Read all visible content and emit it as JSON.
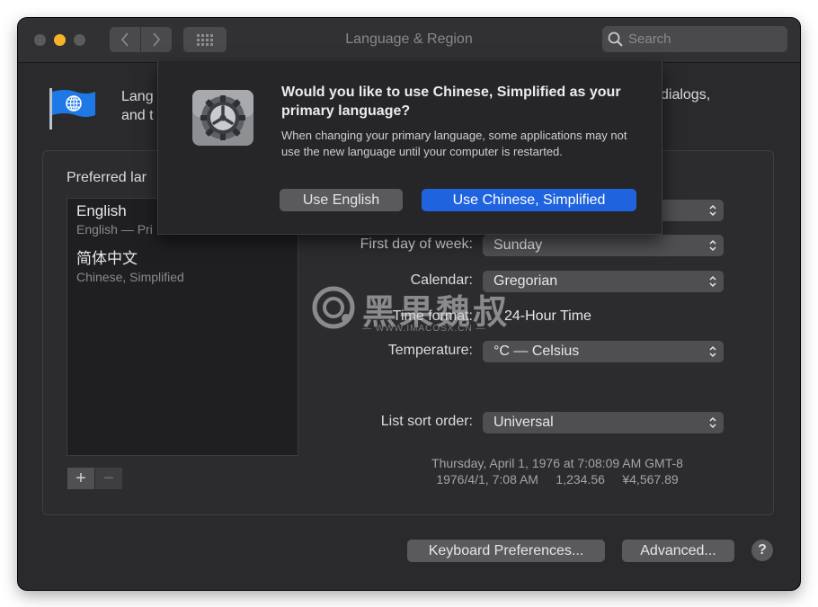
{
  "window": {
    "title": "Language & Region",
    "search_placeholder": "Search",
    "accent_color": "#1f63df"
  },
  "intro": {
    "line1": "Lang",
    "line2": "and t",
    "right_fragment": "dialogs,"
  },
  "preferred_languages": {
    "label": "Preferred lar",
    "items": [
      {
        "name": "English",
        "sub": "English — Pri"
      },
      {
        "name": "简体中文",
        "sub": "Chinese, Simplified"
      }
    ],
    "add_label": "+",
    "remove_label": "−"
  },
  "settings": {
    "first_day_label": "First day of week:",
    "first_day_value": "Sunday",
    "calendar_label": "Calendar:",
    "calendar_value": "Gregorian",
    "time_format_label": "Time format:",
    "time_format_value": "24-Hour Time",
    "temperature_label": "Temperature:",
    "temperature_value": "°C — Celsius",
    "sort_label": "List sort order:",
    "sort_value": "Universal"
  },
  "sample": {
    "line1": "Thursday, April 1, 1976 at 7:08:09 AM GMT-8",
    "line2": "1976/4/1, 7:08 AM     1,234.56     ¥4,567.89"
  },
  "footer": {
    "keyboard_button": "Keyboard Preferences...",
    "advanced_button": "Advanced...",
    "help_label": "?"
  },
  "dialog": {
    "title": "Would you like to use Chinese, Simplified as your primary language?",
    "body": "When changing your primary language, some applications may not use the new language until your computer is restarted.",
    "secondary_button": "Use English",
    "primary_button": "Use Chinese, Simplified"
  },
  "watermark": {
    "text": "黑果魏叔",
    "url": "— WWW.IMACOSX.CN —"
  }
}
